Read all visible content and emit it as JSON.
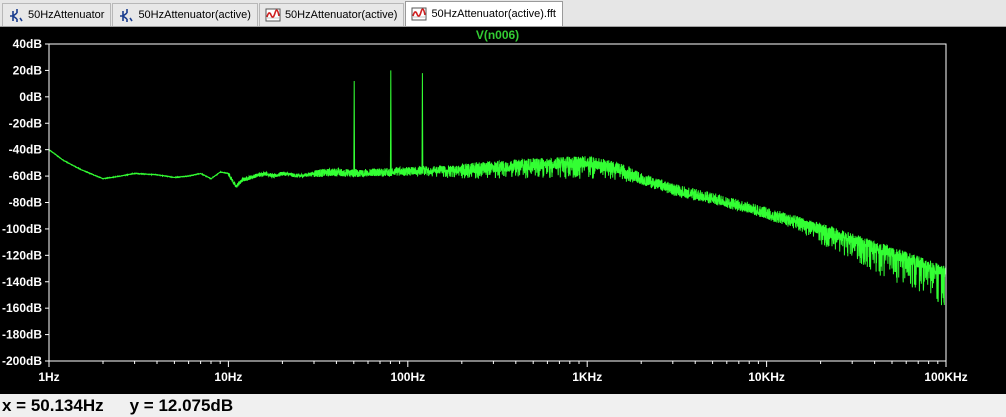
{
  "tabs": [
    {
      "label": "50HzAttenuator",
      "icon": "schematic-icon",
      "active": false
    },
    {
      "label": "50HzAttenuator(active)",
      "icon": "schematic-icon",
      "active": false
    },
    {
      "label": "50HzAttenuator(active)",
      "icon": "waveform-icon",
      "active": false
    },
    {
      "label": "50HzAttenuator(active).fft",
      "icon": "waveform-icon",
      "active": true
    }
  ],
  "colors": {
    "trace": "#33ff33",
    "axis_text": "#ffffff",
    "title": "#33cc33",
    "background": "#000000",
    "frame": "#ffffff"
  },
  "status": {
    "x_readout": "x = 50.134Hz",
    "y_readout": "y = 12.075dB"
  },
  "chart_data": {
    "type": "line",
    "title": "V(n006)",
    "x_scale": "log",
    "xlim": [
      1,
      100000
    ],
    "ylim": [
      -200,
      40
    ],
    "x_tick_labels": [
      "1Hz",
      "10Hz",
      "100Hz",
      "1KHz",
      "10KHz",
      "100KHz"
    ],
    "x_tick_values": [
      1,
      10,
      100,
      1000,
      10000,
      100000
    ],
    "y_tick_labels": [
      "40dB",
      "20dB",
      "0dB",
      "-20dB",
      "-40dB",
      "-60dB",
      "-80dB",
      "-100dB",
      "-120dB",
      "-140dB",
      "-160dB",
      "-180dB",
      "-200dB"
    ],
    "y_tick_values": [
      40,
      20,
      0,
      -20,
      -40,
      -60,
      -80,
      -100,
      -120,
      -140,
      -160,
      -180,
      -200
    ],
    "grid": false,
    "series": [
      {
        "name": "V(n006)",
        "x": [
          1,
          1.2,
          1.5,
          2,
          2.5,
          3,
          4,
          5,
          6,
          7,
          8,
          9,
          10,
          11,
          12,
          14,
          16,
          18,
          20,
          25,
          30,
          40,
          50,
          70,
          100,
          150,
          200,
          300,
          500,
          700,
          1000,
          1500,
          2000,
          3000,
          5000,
          7000,
          10000,
          20000,
          30000,
          50000,
          70000,
          100000
        ],
        "y": [
          -40,
          -48,
          -55,
          -62,
          -60,
          -58,
          -59,
          -61,
          -60,
          -58,
          -62,
          -57,
          -58,
          -68,
          -63,
          -60,
          -58,
          -60,
          -58,
          -60,
          -58,
          -57,
          -58,
          -57,
          -56,
          -55,
          -55,
          -53,
          -51,
          -50,
          -49,
          -54,
          -62,
          -70,
          -77,
          -82,
          -88,
          -100,
          -108,
          -118,
          -125,
          -133
        ],
        "noise_floor_dB": [
          -60,
          -60,
          -62,
          -62,
          -62,
          -62,
          -62,
          -62,
          -62,
          -62,
          -64,
          -66,
          -70,
          -74,
          -78,
          -82,
          -88,
          -95,
          -100,
          -110,
          -118,
          -126,
          -136,
          -144,
          -150,
          -160
        ],
        "spikes": [
          {
            "x": 50,
            "y": 12
          },
          {
            "x": 80,
            "y": 20
          },
          {
            "x": 120,
            "y": 18
          }
        ]
      }
    ]
  }
}
